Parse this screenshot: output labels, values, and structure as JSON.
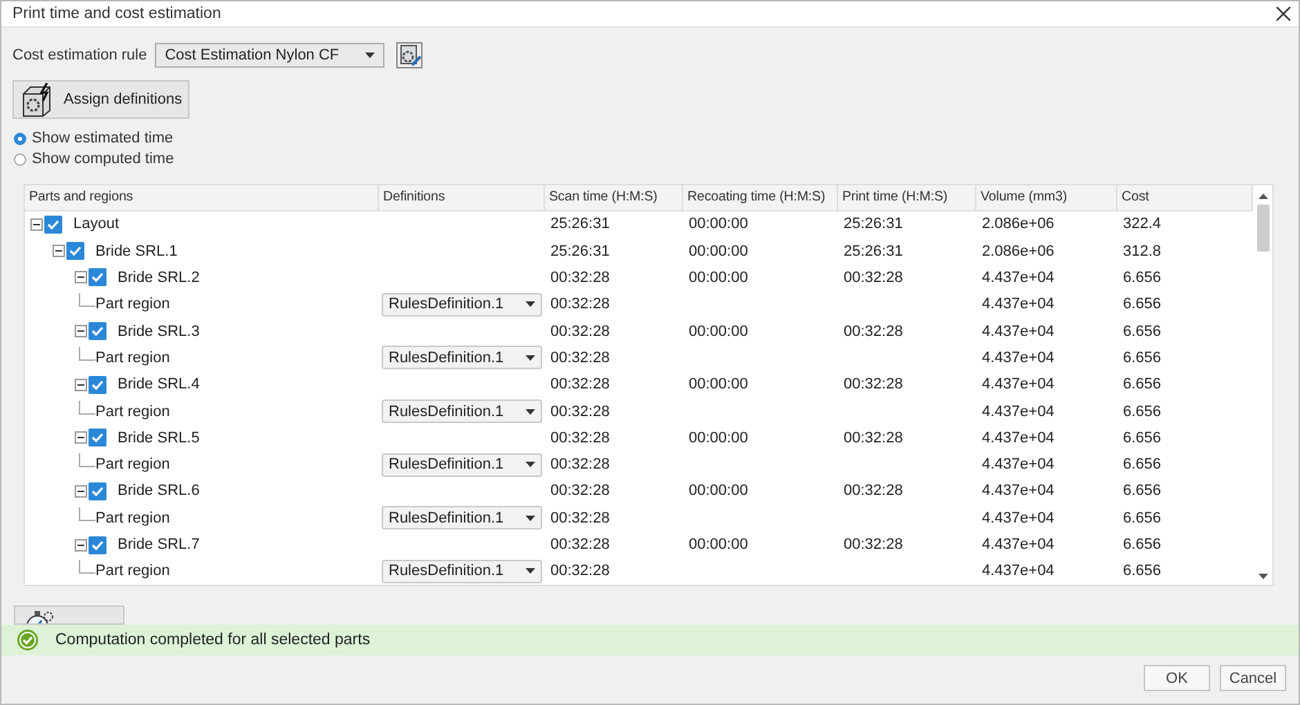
{
  "window": {
    "title": "Print time and cost estimation"
  },
  "cost_rule": {
    "label": "Cost estimation rule",
    "value": "Cost Estimation Nylon CF"
  },
  "assign_button": {
    "label": "Assign definitions"
  },
  "display_options": [
    {
      "label": "Show estimated time",
      "selected": true
    },
    {
      "label": "Show computed time",
      "selected": false
    }
  ],
  "table": {
    "columns": [
      "Parts and regions",
      "Definitions",
      "Scan time (H:M:S)",
      "Recoating time (H:M:S)",
      "Print time (H:M:S)",
      "Volume (mm3)",
      "Cost"
    ],
    "rows": [
      {
        "kind": "part",
        "name": "Layout",
        "checked": true,
        "expanded": true,
        "scan": "25:26:31",
        "recoat": "00:00:00",
        "print": "25:26:31",
        "volume": "2.086e+06",
        "cost": "322.4",
        "children": [
          {
            "kind": "part",
            "name": "Bride SRL.1",
            "checked": true,
            "expanded": true,
            "scan": "25:26:31",
            "recoat": "00:00:00",
            "print": "25:26:31",
            "volume": "2.086e+06",
            "cost": "312.8",
            "children": [
              {
                "kind": "part",
                "name": "Bride SRL.2",
                "checked": true,
                "expanded": true,
                "scan": "00:32:28",
                "recoat": "00:00:00",
                "print": "00:32:28",
                "volume": "4.437e+04",
                "cost": "6.656",
                "children": [
                  {
                    "kind": "region",
                    "name": "Part region",
                    "definition": "RulesDefinition.1",
                    "scan": "00:32:28",
                    "volume": "4.437e+04",
                    "cost": "6.656"
                  }
                ]
              },
              {
                "kind": "part",
                "name": "Bride SRL.3",
                "checked": true,
                "expanded": true,
                "scan": "00:32:28",
                "recoat": "00:00:00",
                "print": "00:32:28",
                "volume": "4.437e+04",
                "cost": "6.656",
                "children": [
                  {
                    "kind": "region",
                    "name": "Part region",
                    "definition": "RulesDefinition.1",
                    "scan": "00:32:28",
                    "volume": "4.437e+04",
                    "cost": "6.656"
                  }
                ]
              },
              {
                "kind": "part",
                "name": "Bride SRL.4",
                "checked": true,
                "expanded": true,
                "scan": "00:32:28",
                "recoat": "00:00:00",
                "print": "00:32:28",
                "volume": "4.437e+04",
                "cost": "6.656",
                "children": [
                  {
                    "kind": "region",
                    "name": "Part region",
                    "definition": "RulesDefinition.1",
                    "scan": "00:32:28",
                    "volume": "4.437e+04",
                    "cost": "6.656"
                  }
                ]
              },
              {
                "kind": "part",
                "name": "Bride SRL.5",
                "checked": true,
                "expanded": true,
                "scan": "00:32:28",
                "recoat": "00:00:00",
                "print": "00:32:28",
                "volume": "4.437e+04",
                "cost": "6.656",
                "children": [
                  {
                    "kind": "region",
                    "name": "Part region",
                    "definition": "RulesDefinition.1",
                    "scan": "00:32:28",
                    "volume": "4.437e+04",
                    "cost": "6.656"
                  }
                ]
              },
              {
                "kind": "part",
                "name": "Bride SRL.6",
                "checked": true,
                "expanded": true,
                "scan": "00:32:28",
                "recoat": "00:00:00",
                "print": "00:32:28",
                "volume": "4.437e+04",
                "cost": "6.656",
                "children": [
                  {
                    "kind": "region",
                    "name": "Part region",
                    "definition": "RulesDefinition.1",
                    "scan": "00:32:28",
                    "volume": "4.437e+04",
                    "cost": "6.656"
                  }
                ]
              },
              {
                "kind": "part",
                "name": "Bride SRL.7",
                "checked": true,
                "expanded": true,
                "scan": "00:32:28",
                "recoat": "00:00:00",
                "print": "00:32:28",
                "volume": "4.437e+04",
                "cost": "6.656",
                "children": [
                  {
                    "kind": "region",
                    "name": "Part region",
                    "definition": "RulesDefinition.1",
                    "scan": "00:32:28",
                    "volume": "4.437e+04",
                    "cost": "6.656"
                  }
                ]
              }
            ]
          }
        ]
      }
    ]
  },
  "status_bar": {
    "kind": "success",
    "message": "Computation completed for all selected parts"
  },
  "buttons": [
    "OK",
    "Cancel"
  ]
}
